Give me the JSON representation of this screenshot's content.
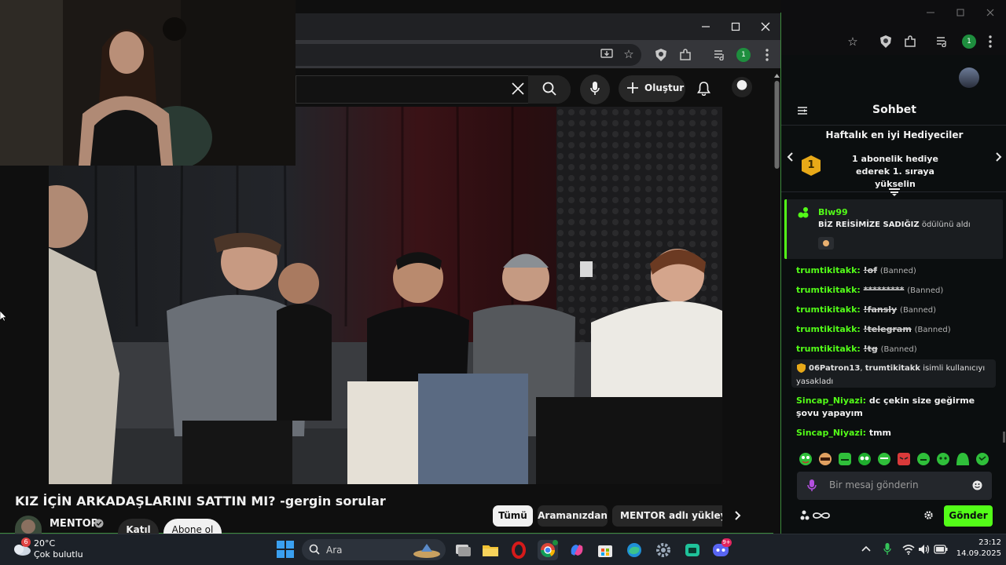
{
  "youtube": {
    "create_label": "Oluştur",
    "video_title": "KIZ İÇİN ARKADAŞLARINI SATTIN MI? -gergin sorular",
    "channel_name": "MENTOR",
    "join_label": "Katıl",
    "subscribe_label": "Abone ol",
    "chips": [
      "Tümü",
      "Aramanızdan",
      "MENTOR adlı yükleyicide"
    ]
  },
  "chat": {
    "header": "Sohbet",
    "gifters_title": "Haftalık en iyi Hediyeciler",
    "gifters_rank": "1",
    "gifters_text": "1 abonelik hediye ederek 1. sıraya yükselin",
    "reward": {
      "user": "Blw99",
      "reward_name": "BİZ REİSİMİZE SADIĞIZ",
      "suffix": "ödülünü aldı"
    },
    "messages": [
      {
        "user": "trumtikitakk:",
        "text": "!of",
        "status": "(Banned)"
      },
      {
        "user": "trumtikitakk:",
        "text": "*********",
        "status": "(Banned)"
      },
      {
        "user": "trumtikitakk:",
        "text": "!fansly",
        "status": "(Banned)"
      },
      {
        "user": "trumtikitakk:",
        "text": "!telegram",
        "status": "(Banned)"
      },
      {
        "user": "trumtikitakk:",
        "text": "!tg",
        "status": "(Banned)"
      }
    ],
    "ban_notice": {
      "mod": "06Patron13",
      "target": "trumtikitakk",
      "text": "isimli kullanıcıyı yasakladı"
    },
    "messages2": [
      {
        "user": "Sincap_Niyazi:",
        "text": "dc çekin size geğirme şovu yapayım"
      },
      {
        "user": "Sincap_Niyazi:",
        "text": "tmm"
      }
    ],
    "input_placeholder": "Bir mesaj gönderin",
    "send_label": "Gönder"
  },
  "taskbar": {
    "weather_temp": "20°C",
    "weather_desc": "Çok bulutlu",
    "weather_badge": "6",
    "search_label": "Ara",
    "time": "23:12",
    "date": "14.09.2025",
    "discord_badge": "9+"
  },
  "colors": {
    "kick_green": "#53fc18",
    "youtube_bg": "#0f0f0f",
    "taskbar_bg": "#1c2128"
  }
}
